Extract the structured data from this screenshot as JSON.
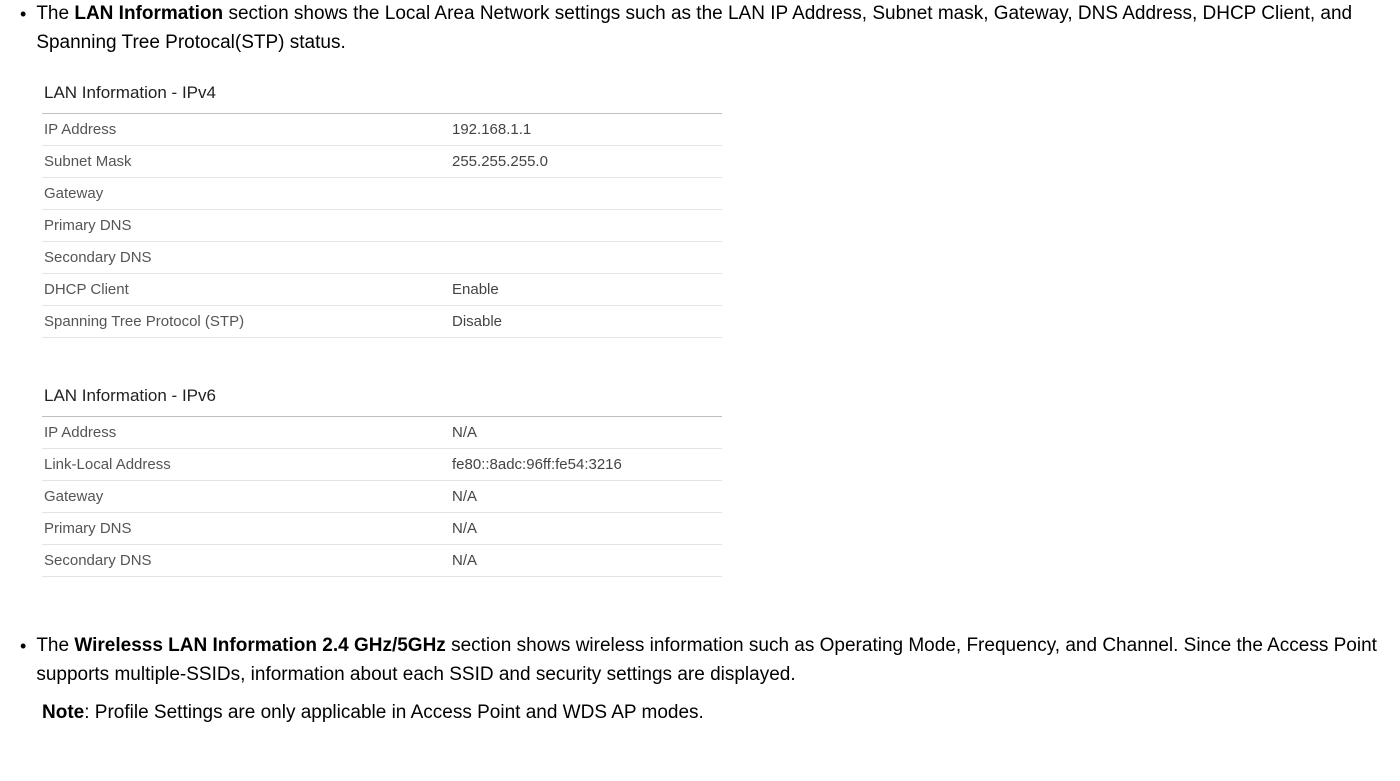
{
  "bullet1": {
    "prefix": "The ",
    "bold": "LAN Information",
    "suffix": " section shows the Local Area Network settings such as the LAN IP Address, Subnet mask, Gateway, DNS Address, DHCP Client, and Spanning Tree Protocal(STP) status."
  },
  "ipv4": {
    "title": "LAN Information - IPv4",
    "rows": [
      {
        "label": "IP Address",
        "value": "192.168.1.1"
      },
      {
        "label": "Subnet Mask",
        "value": "255.255.255.0"
      },
      {
        "label": "Gateway",
        "value": ""
      },
      {
        "label": "Primary DNS",
        "value": ""
      },
      {
        "label": "Secondary DNS",
        "value": ""
      },
      {
        "label": "DHCP Client",
        "value": "Enable"
      },
      {
        "label": "Spanning Tree Protocol (STP)",
        "value": "Disable"
      }
    ]
  },
  "ipv6": {
    "title": "LAN Information - IPv6",
    "rows": [
      {
        "label": "IP Address",
        "value": "N/A"
      },
      {
        "label": "Link-Local Address",
        "value": "fe80::8adc:96ff:fe54:3216"
      },
      {
        "label": "Gateway",
        "value": "N/A"
      },
      {
        "label": "Primary DNS",
        "value": "N/A"
      },
      {
        "label": "Secondary DNS",
        "value": "N/A"
      }
    ]
  },
  "bullet2": {
    "prefix": "The ",
    "bold": "Wirelesss LAN Information 2.4 GHz/5GHz",
    "suffix": " section shows wireless information such as Operating Mode, Frequency, and Channel. Since the Access Point supports multiple-SSIDs, information about each SSID and security settings are displayed."
  },
  "note": {
    "bold": "Note",
    "suffix": ": Profile Settings are only applicable in Access Point and WDS AP modes."
  }
}
